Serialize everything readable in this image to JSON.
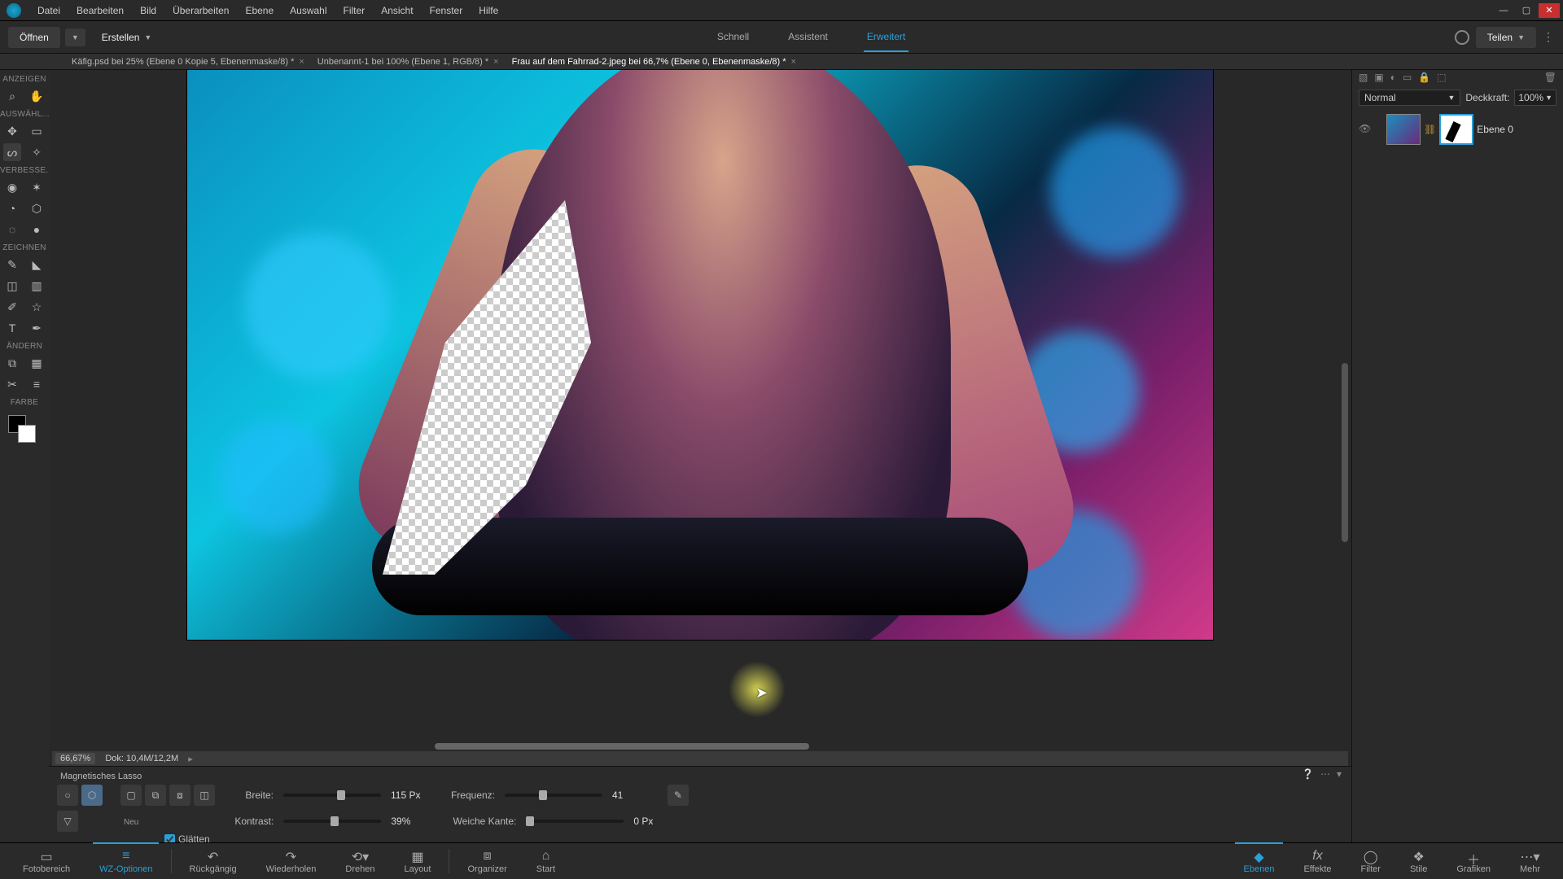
{
  "menu": {
    "items": [
      "Datei",
      "Bearbeiten",
      "Bild",
      "Überarbeiten",
      "Ebene",
      "Auswahl",
      "Filter",
      "Ansicht",
      "Fenster",
      "Hilfe"
    ]
  },
  "actions": {
    "open": "Öffnen",
    "create": "Erstellen",
    "share": "Teilen"
  },
  "modes": {
    "fast": "Schnell",
    "assist": "Assistent",
    "expert": "Erweitert"
  },
  "tabs": [
    {
      "label": "Käfig.psd bei 25% (Ebene 0 Kopie 5, Ebenenmaske/8) *",
      "active": false
    },
    {
      "label": "Unbenannt-1 bei 100% (Ebene 1, RGB/8) *",
      "active": false
    },
    {
      "label": "Frau auf dem Fahrrad-2.jpeg bei 66,7% (Ebene 0, Ebenenmaske/8) *",
      "active": true
    }
  ],
  "toolbox": {
    "sections": {
      "view": "ANZEIGEN",
      "select": "AUSWÄHL...",
      "enhance": "VERBESSE...",
      "draw": "ZEICHNEN",
      "modify": "ÄNDERN",
      "color": "FARBE"
    }
  },
  "status": {
    "zoom": "66,67%",
    "doc": "Dok: 10,4M/12,2M"
  },
  "options": {
    "title": "Magnetisches Lasso",
    "neu": "Neu",
    "width_label": "Breite:",
    "width_val": "115 Px",
    "width_pct": 55,
    "contrast_label": "Kontrast:",
    "contrast_val": "39%",
    "contrast_pct": 48,
    "freq_label": "Frequenz:",
    "freq_val": "41",
    "freq_pct": 35,
    "feather_label": "Weiche Kante:",
    "feather_val": "0 Px",
    "feather_pct": 0,
    "smooth_label": "Glätten",
    "smooth_checked": true
  },
  "layers": {
    "blend": "Normal",
    "opacity_label": "Deckkraft:",
    "opacity_val": "100%",
    "layer0": "Ebene 0",
    "trash": "🗑"
  },
  "bottombar": {
    "left": [
      {
        "name": "fotobereich",
        "label": "Fotobereich",
        "icon": "▭"
      },
      {
        "name": "wz-optionen",
        "label": "WZ-Optionen",
        "icon": "≡",
        "active": true
      },
      {
        "name": "rueckgaengig",
        "label": "Rückgängig",
        "icon": "↶"
      },
      {
        "name": "wiederholen",
        "label": "Wiederholen",
        "icon": "↷"
      },
      {
        "name": "drehen",
        "label": "Drehen",
        "icon": "⟲"
      },
      {
        "name": "layout",
        "label": "Layout",
        "icon": "▦"
      },
      {
        "name": "organizer",
        "label": "Organizer",
        "icon": "⧈"
      },
      {
        "name": "start",
        "label": "Start",
        "icon": "⌂"
      }
    ],
    "right": [
      {
        "name": "ebenen",
        "label": "Ebenen",
        "icon": "◆",
        "active": true
      },
      {
        "name": "effekte",
        "label": "Effekte",
        "icon": "fx"
      },
      {
        "name": "filter",
        "label": "Filter",
        "icon": "◯"
      },
      {
        "name": "stile",
        "label": "Stile",
        "icon": "❖"
      },
      {
        "name": "grafiken",
        "label": "Grafiken",
        "icon": "＋"
      },
      {
        "name": "mehr",
        "label": "Mehr",
        "icon": "⋯"
      }
    ]
  }
}
